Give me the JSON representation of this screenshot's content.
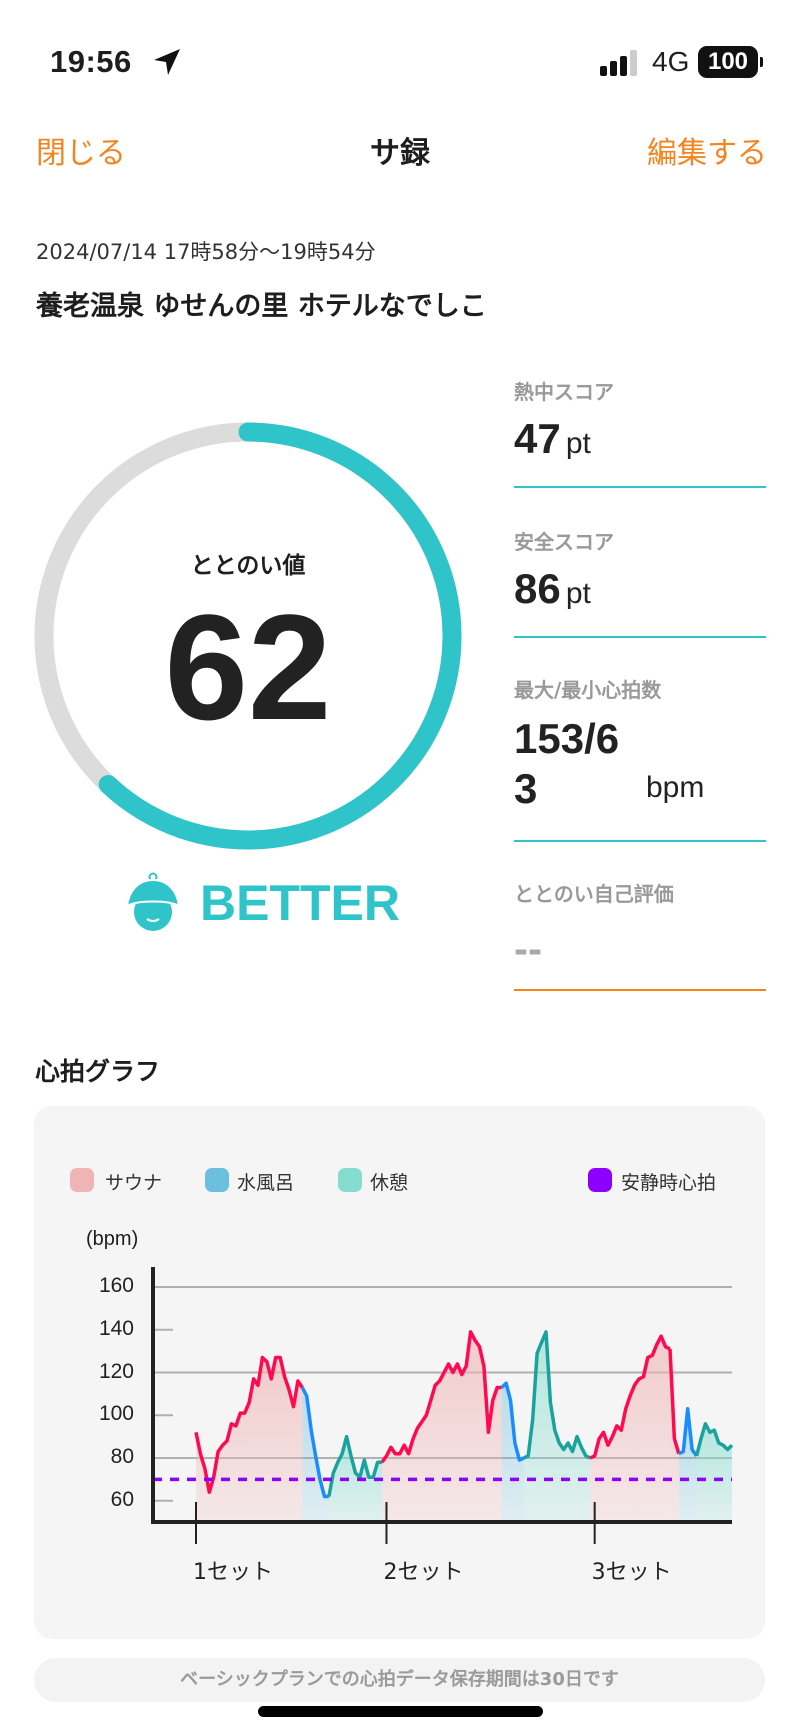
{
  "status_bar": {
    "time": "19:56",
    "network": "4G",
    "battery": "100",
    "icons": [
      "location-arrow-icon",
      "signal-icon",
      "battery-icon"
    ]
  },
  "nav": {
    "close": "閉じる",
    "title": "サ録",
    "edit": "編集する"
  },
  "session": {
    "datetime": "2024/07/14 17時58分〜19時54分",
    "place": "養老温泉 ゆせんの里 ホテルなでしこ"
  },
  "totonoi": {
    "label": "ととのい値",
    "value": "62",
    "progress_percent": 62,
    "rank": "BETTER",
    "rank_icon": "sauna-hat-face-icon"
  },
  "scores": [
    {
      "label": "熱中スコア",
      "value": "47",
      "unit": "pt"
    },
    {
      "label": "安全スコア",
      "value": "86",
      "unit": "pt"
    },
    {
      "label": "最大/最小心拍数",
      "value": "153/6",
      "value2": "3",
      "unit": "bpm"
    },
    {
      "label": "ととのい自己評価",
      "value": "--"
    }
  ],
  "colors": {
    "accent": "#2ec4c9",
    "orange": "#f5841f",
    "sauna": "#ff0a50",
    "water": "#1a8cff",
    "rest": "#1aa39c",
    "resting_hr": "#8b00ff"
  },
  "graph": {
    "title": "心拍グラフ",
    "notice": "ベーシックプランでの心拍データ保存期間は30日です"
  },
  "chart_data": {
    "type": "line",
    "ylabel": "(bpm)",
    "ylim": [
      50,
      168
    ],
    "yticks": [
      160,
      140,
      120,
      100,
      80,
      60
    ],
    "legend": [
      {
        "name": "サウナ",
        "color": "#f0b4b4"
      },
      {
        "name": "水風呂",
        "color": "#6bbfdf"
      },
      {
        "name": "休憩",
        "color": "#86dccf"
      },
      {
        "name": "安静時心拍",
        "color": "#8b00ff"
      }
    ],
    "x_labels": [
      "1セット",
      "2セット",
      "3セット"
    ],
    "resting_hr": 70,
    "segments": [
      {
        "phase": "sauna",
        "set": 1,
        "values": [
          92,
          82,
          75,
          64,
          71,
          83,
          86,
          88,
          96,
          95,
          101,
          101,
          106,
          117,
          114,
          127,
          125,
          117,
          127,
          127,
          118,
          112,
          104,
          116,
          113
        ]
      },
      {
        "phase": "water",
        "values": [
          109,
          93,
          81,
          70,
          62,
          62
        ]
      },
      {
        "phase": "rest",
        "values": [
          73,
          78,
          82,
          90,
          81,
          73,
          71,
          79,
          71,
          71,
          78,
          78
        ]
      },
      {
        "phase": "sauna",
        "set": 2,
        "values": [
          81,
          85,
          82,
          82,
          86,
          82,
          89,
          94,
          97,
          100,
          107,
          114,
          116,
          120,
          124,
          120,
          124,
          119,
          123,
          139,
          135,
          132,
          123,
          92,
          107,
          113,
          113
        ]
      },
      {
        "phase": "water",
        "values": [
          115,
          107,
          87,
          79,
          80
        ]
      },
      {
        "phase": "rest",
        "values": [
          81,
          98,
          129,
          134,
          139,
          106,
          93,
          87,
          84,
          87,
          83,
          90,
          85,
          81,
          80
        ]
      },
      {
        "phase": "sauna",
        "set": 3,
        "values": [
          81,
          89,
          92,
          86,
          90,
          95,
          93,
          103,
          109,
          114,
          117,
          118,
          127,
          128,
          133,
          137,
          132,
          131
        ]
      },
      {
        "phase": "sauna",
        "values": [
          89,
          82
        ]
      },
      {
        "phase": "water",
        "values": [
          83,
          103,
          84,
          81
        ]
      },
      {
        "phase": "rest",
        "values": [
          89,
          96,
          92,
          93,
          87,
          86,
          84,
          86
        ]
      }
    ]
  }
}
